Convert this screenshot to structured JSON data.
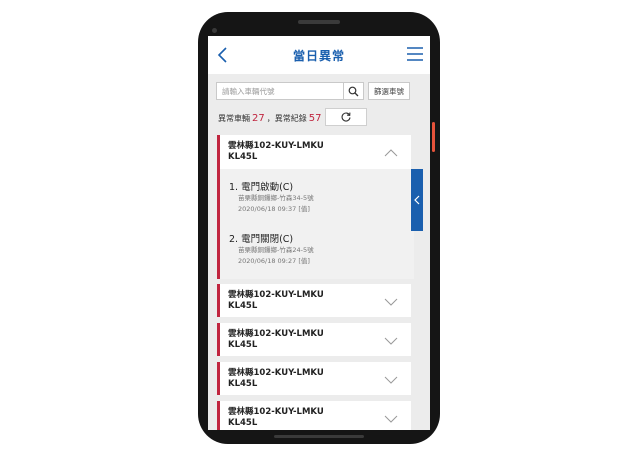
{
  "header": {
    "title": "當日異常"
  },
  "search": {
    "placeholder": "請輸入車輛代號",
    "filter_label": "篩選車號"
  },
  "summary": {
    "vehicles_label": "異常車輛",
    "vehicles_count": "27",
    "records_label": "，異常紀錄",
    "records_count": "57"
  },
  "vehicles": [
    {
      "line1": "雲林縣102-KUY-LMKU",
      "line2": "KL45L",
      "expanded": true,
      "events": [
        {
          "title": "1. 電門啟動(C)",
          "location": "苗栗縣銅鑼鄉-竹森34-5號",
          "time": "2020/06/18 09:37 [值]"
        },
        {
          "title": "2. 電門關閉(C)",
          "location": "苗栗縣銅鑼鄉-竹森24-5號",
          "time": "2020/06/18 09:27 [值]"
        }
      ]
    },
    {
      "line1": "雲林縣102-KUY-LMKU",
      "line2": "KL45L",
      "expanded": false
    },
    {
      "line1": "雲林縣102-KUY-LMKU",
      "line2": "KL45L",
      "expanded": false
    },
    {
      "line1": "雲林縣102-KUY-LMKU",
      "line2": "KL45L",
      "expanded": false
    },
    {
      "line1": "雲林縣102-KUY-LMKU",
      "line2": "KL45L",
      "expanded": false
    }
  ],
  "colors": {
    "brand_blue": "#1a5fae",
    "alert_red": "#c0253f",
    "device_accent": "#e7533b"
  },
  "icons": {
    "back": "chevron-left-icon",
    "menu": "hamburger-menu-icon",
    "search": "search-icon",
    "refresh": "refresh-icon",
    "expand": "chevron-down-icon",
    "collapse": "chevron-up-icon",
    "side_tab": "chevron-left-icon"
  }
}
